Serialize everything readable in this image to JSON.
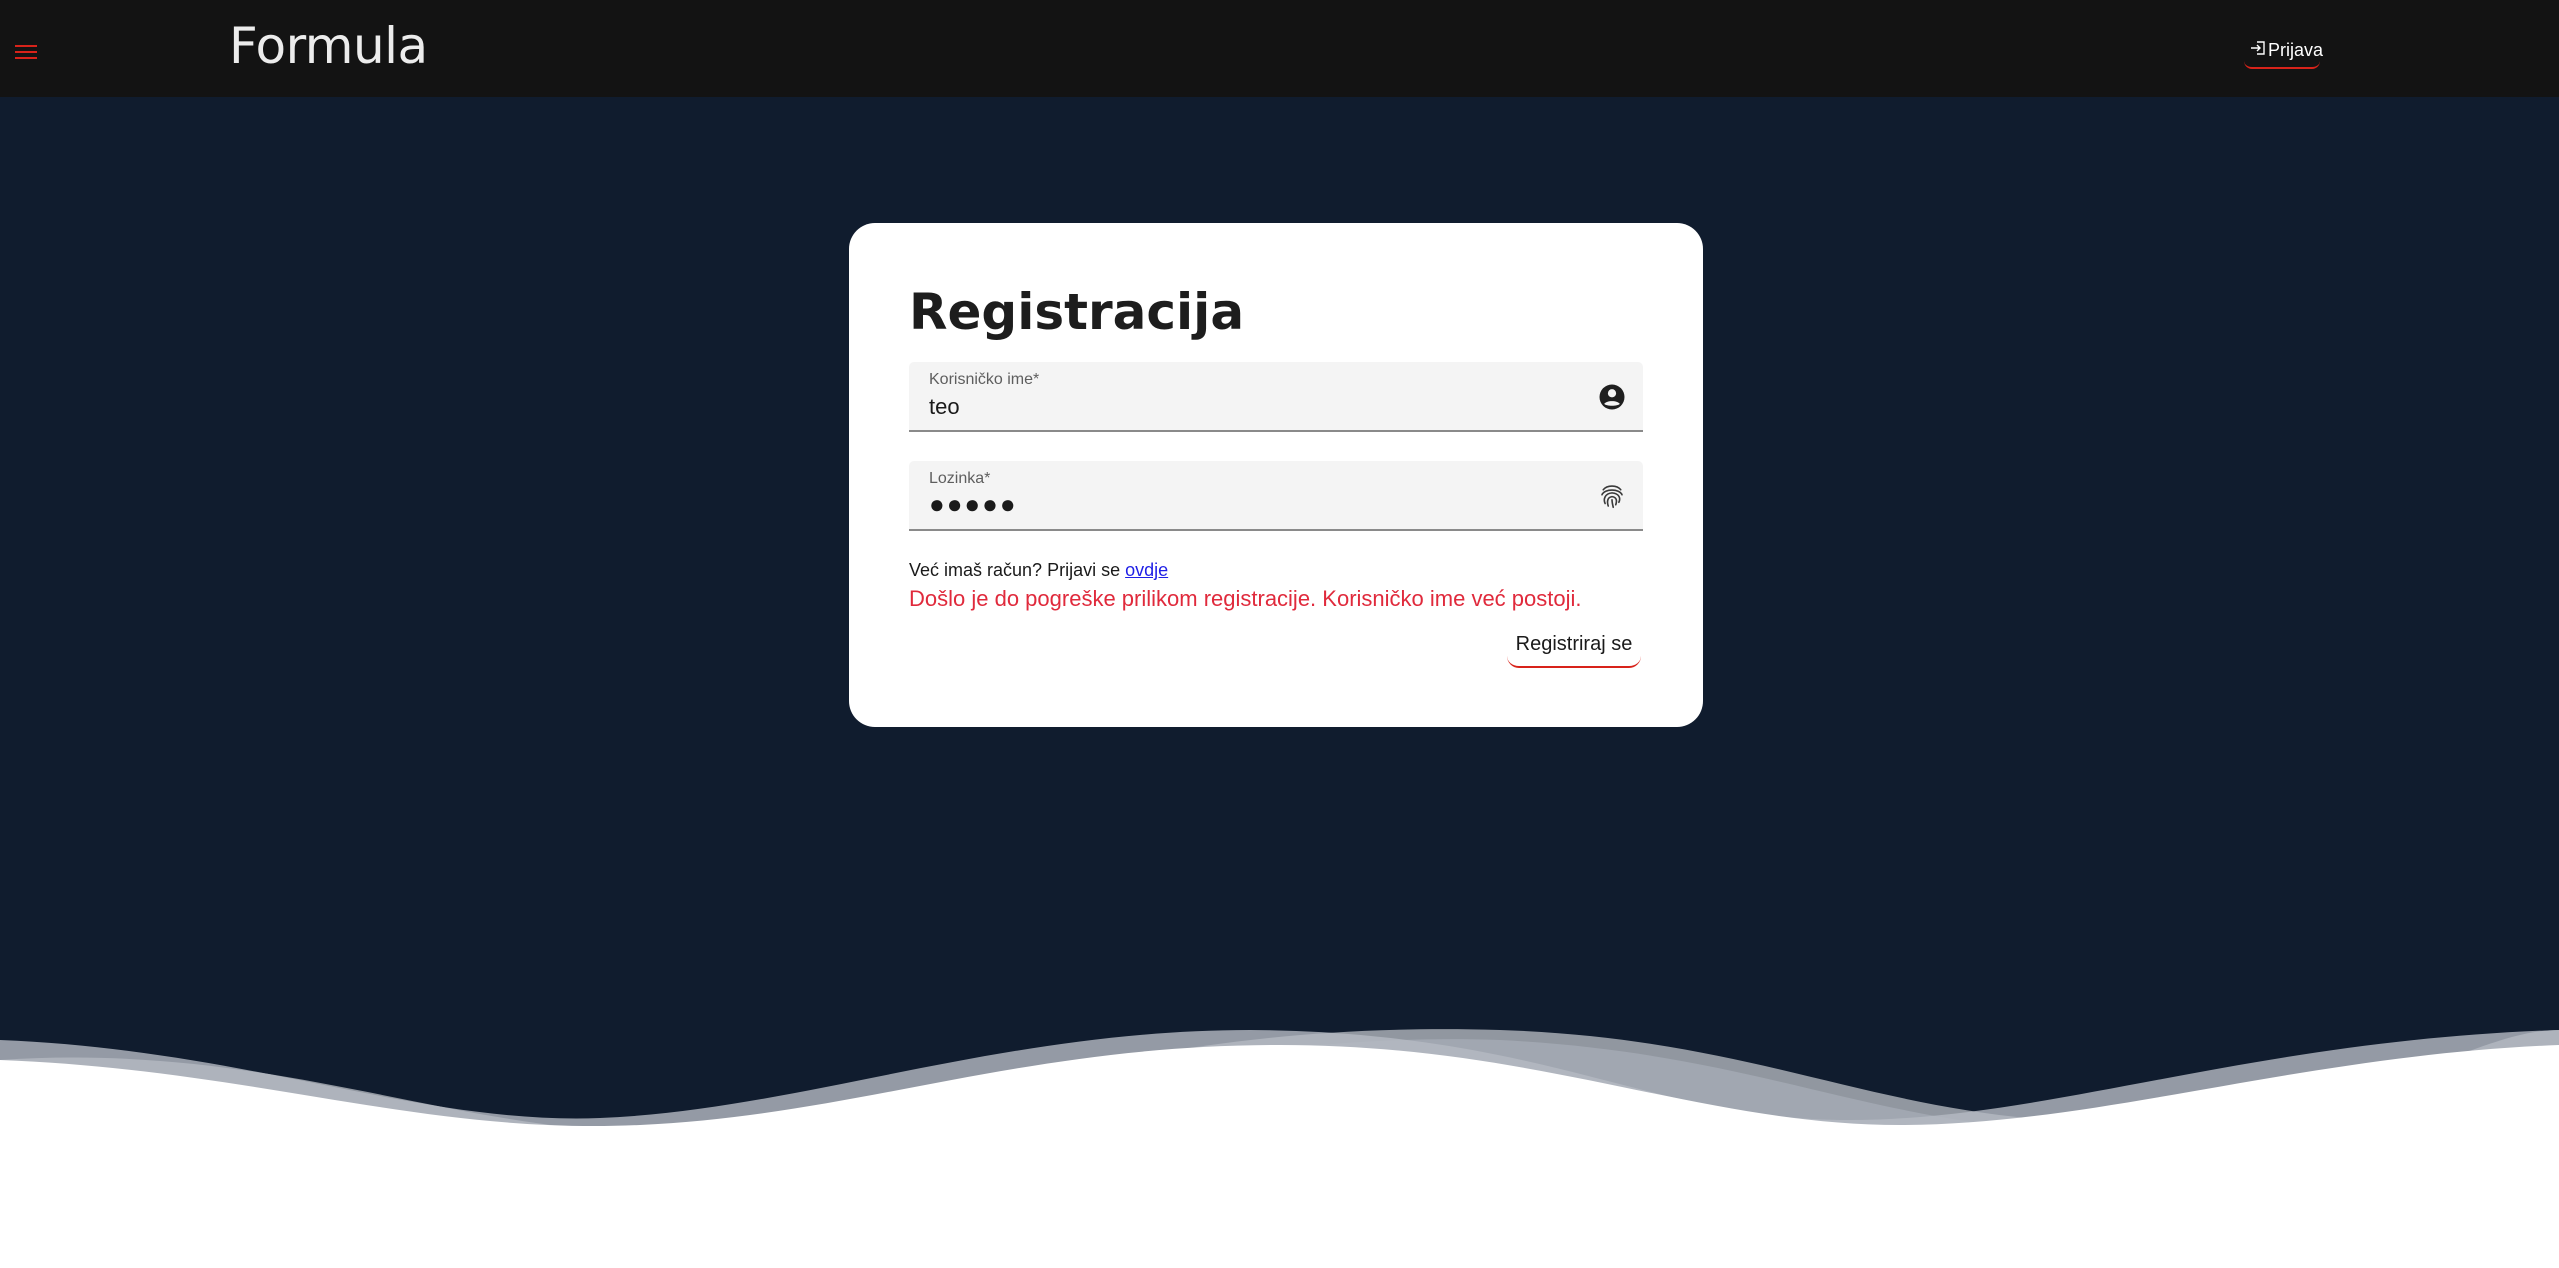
{
  "header": {
    "brand": "Formula",
    "login_label": "Prijava",
    "menu_icon": "hamburger-icon",
    "login_icon": "login-icon"
  },
  "form": {
    "title": "Registracija",
    "username": {
      "label": "Korisničko ime*",
      "value": "teo",
      "icon": "account-circle-icon"
    },
    "password": {
      "label": "Lozinka*",
      "value": "●●●●●",
      "icon": "fingerprint-icon"
    },
    "prompt_text": "Već imaš račun? Prijavi se",
    "prompt_link": "ovdje",
    "error": "Došlo je do pogreške prilikom registracije. Korisničko ime već postoji.",
    "submit_label": "Registriraj se"
  },
  "colors": {
    "header_bg": "#131313",
    "page_bg": "#101c2e",
    "accent": "#d8231a",
    "error": "#e02a3c",
    "link": "#1f1fe6"
  }
}
